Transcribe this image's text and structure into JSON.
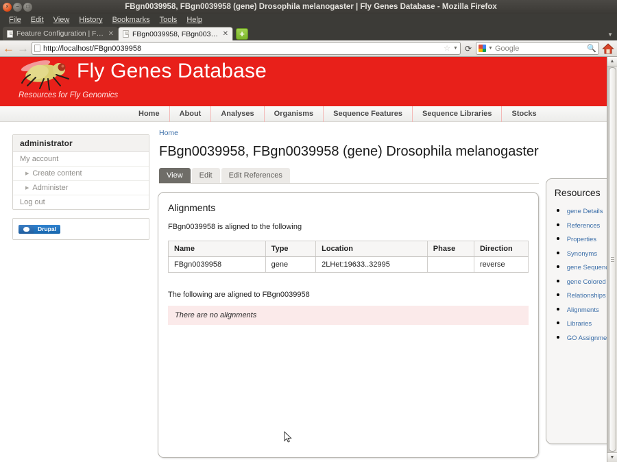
{
  "browser": {
    "window_title": "FBgn0039958, FBgn0039958 (gene) Drosophila melanogaster | Fly Genes Database - Mozilla Firefox",
    "window_controls": {
      "close": "close-button",
      "minimize": "minimize-button",
      "maximize": "maximize-button"
    },
    "menus": [
      "File",
      "Edit",
      "View",
      "History",
      "Bookmarks",
      "Tools",
      "Help"
    ],
    "tabs": [
      {
        "label": "Feature Configuration | Fly ...",
        "active": false
      },
      {
        "label": "FBgn0039958, FBgn0039958...",
        "active": true
      }
    ],
    "new_tab_label": "+",
    "toolbar": {
      "back_label": "←",
      "forward_label": "→",
      "url": "http://localhost/FBgn0039958",
      "star_label": "☆",
      "reload_label": "⟳",
      "search_placeholder": "Google",
      "search_value": "Google",
      "home_label": "home-button"
    }
  },
  "site": {
    "title": "Fly Genes Database",
    "tagline": "Resources for Fly Genomics",
    "header_color": "#e8201a",
    "nav": [
      "Home",
      "About",
      "Analyses",
      "Organisms",
      "Sequence Features",
      "Sequence Libraries",
      "Stocks"
    ]
  },
  "sidebar": {
    "user_block_title": "administrator",
    "items": [
      {
        "label": "My account",
        "expandable": false
      },
      {
        "label": "Create content",
        "expandable": true
      },
      {
        "label": "Administer",
        "expandable": true
      },
      {
        "label": "Log out",
        "expandable": false
      }
    ],
    "drupal_badge": "Drupal"
  },
  "content": {
    "breadcrumb": "Home",
    "page_title": "FBgn0039958, FBgn0039958 (gene) Drosophila melanogaster",
    "tabs": [
      {
        "label": "View",
        "active": true
      },
      {
        "label": "Edit",
        "active": false
      },
      {
        "label": "Edit References",
        "active": false
      }
    ],
    "panel_title": "Alignments",
    "aligned_to_text": "FBgn0039958 is aligned to the following",
    "table": {
      "columns": [
        "Name",
        "Type",
        "Location",
        "Phase",
        "Direction"
      ],
      "rows": [
        {
          "name": "FBgn0039958",
          "type": "gene",
          "location": "2LHet:19633..32995",
          "phase": "",
          "direction": "reverse"
        }
      ]
    },
    "following_text": "The following are aligned to FBgn0039958",
    "no_alignments_text": "There are no alignments",
    "no_alignments_bg": "#fbeaea"
  },
  "resources": {
    "title": "Resources",
    "links": [
      "gene Details",
      "References",
      "Properties",
      "Synonyms",
      "gene Sequence",
      "gene Colored Sequence",
      "Relationships",
      "Alignments",
      "Libraries",
      "GO Assignments"
    ]
  }
}
